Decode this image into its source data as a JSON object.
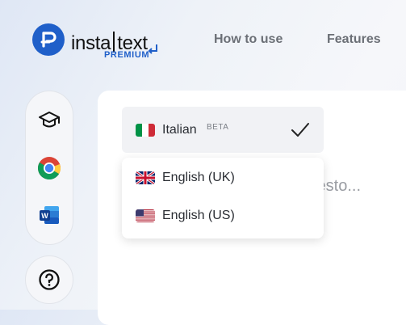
{
  "brand": {
    "name_left": "insta",
    "name_right": "text",
    "tier": "PREMIUM",
    "color": "#1f5fc9"
  },
  "nav": {
    "how_to_use": "How to use",
    "features": "Features"
  },
  "sidebar": {
    "items": [
      {
        "icon": "graduation-cap-icon"
      },
      {
        "icon": "chrome-icon"
      },
      {
        "icon": "word-icon"
      }
    ],
    "help_icon": "help-icon"
  },
  "language_selector": {
    "selected": {
      "label": "Italian",
      "badge": "BETA",
      "flag": "italy-flag-icon"
    },
    "options": [
      {
        "label": "English (UK)",
        "flag": "uk-flag-icon"
      },
      {
        "label": "English (US)",
        "flag": "us-flag-icon"
      }
    ]
  },
  "editor": {
    "placeholder_fragment": "testo..."
  }
}
